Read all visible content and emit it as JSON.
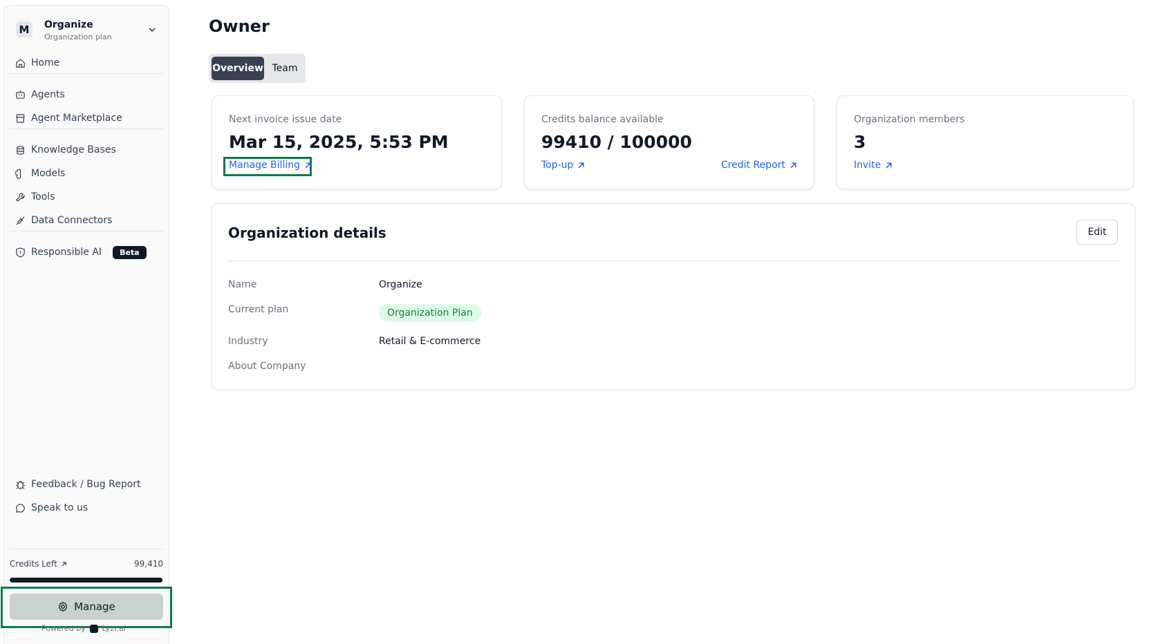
{
  "sidebar": {
    "org_initial": "M",
    "org_name": "Organize",
    "org_plan": "Organization plan",
    "items": [
      {
        "label": "Home"
      },
      {
        "label": "Agents"
      },
      {
        "label": "Agent Marketplace"
      },
      {
        "label": "Knowledge Bases"
      },
      {
        "label": "Models"
      },
      {
        "label": "Tools"
      },
      {
        "label": "Data Connectors"
      },
      {
        "label": "Responsible AI",
        "badge": "Beta"
      }
    ],
    "footer_items": [
      {
        "label": "Feedback / Bug Report"
      },
      {
        "label": "Speak to us"
      }
    ],
    "credits_label": "Credits Left",
    "credits_value": "99,410",
    "credits_fraction": 0.9941,
    "manage_label": "Manage",
    "powered_by": "Powered by",
    "brand": "Lyzr.ai"
  },
  "main": {
    "title": "Owner",
    "tabs": [
      {
        "label": "Overview",
        "active": true
      },
      {
        "label": "Team",
        "active": false
      }
    ],
    "cards": [
      {
        "label": "Next invoice issue date",
        "value": "Mar 15, 2025, 5:53 PM",
        "links": [
          "Manage Billing"
        ]
      },
      {
        "label": "Credits balance available",
        "value": "99410 / 100000",
        "links": [
          "Top-up",
          "Credit Report"
        ]
      },
      {
        "label": "Organization members",
        "value": "3",
        "links": [
          "Invite"
        ]
      }
    ],
    "details": {
      "title": "Organization details",
      "edit_label": "Edit",
      "fields": [
        {
          "label": "Name",
          "value": "Organize"
        },
        {
          "label": "Current plan",
          "value": "Organization Plan"
        },
        {
          "label": "Industry",
          "value": "Retail & E-commerce"
        },
        {
          "label": "About Company",
          "value": ""
        }
      ]
    }
  },
  "colors": {
    "accent_link": "#2563eb",
    "highlight_outline": "#0a7a4f",
    "plan_pill_bg": "#dcfce7",
    "plan_pill_text": "#15803d"
  }
}
